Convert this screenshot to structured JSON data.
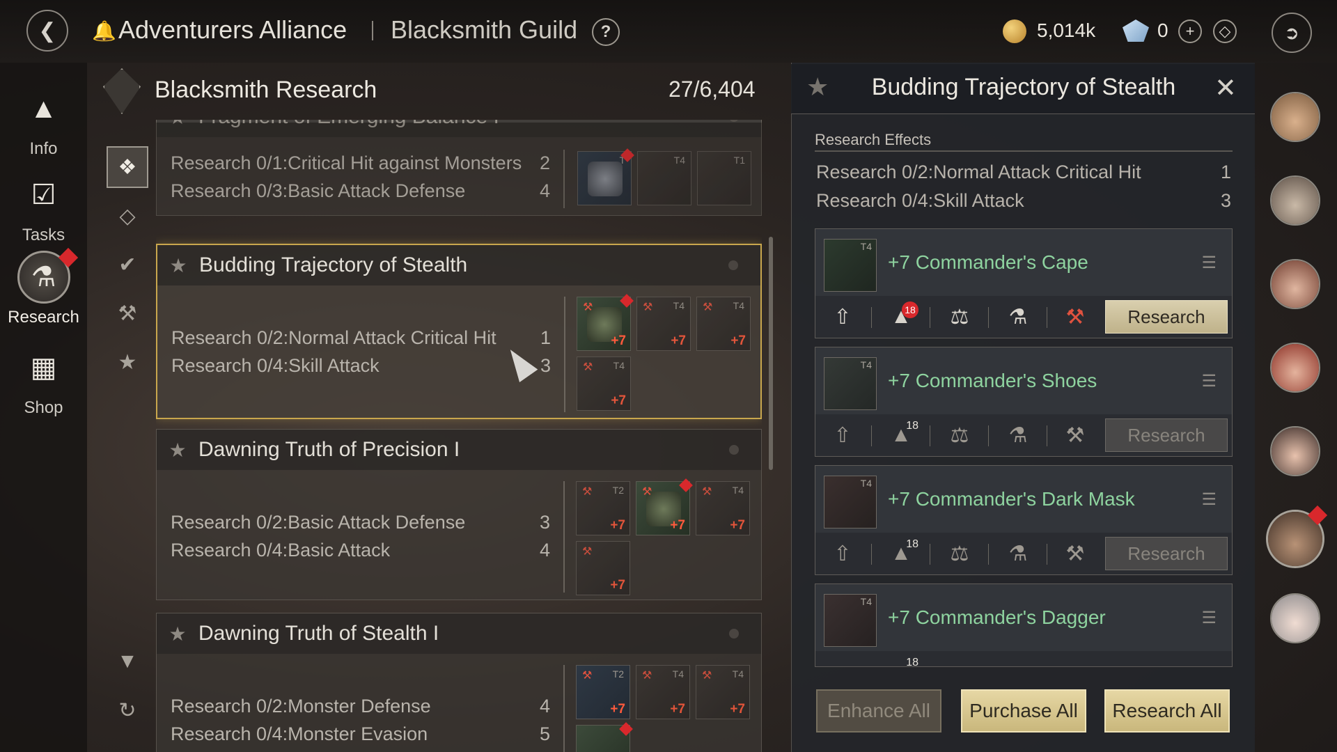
{
  "topbar": {
    "breadcrumb_1": "Adventurers Alliance",
    "breadcrumb_2": "Blacksmith Guild",
    "help": "?",
    "gold": "5,014k",
    "gems": "0",
    "add": "+",
    "more": "◇"
  },
  "leftnav": {
    "items": [
      {
        "label": "Info",
        "icon": "info-icon"
      },
      {
        "label": "Tasks",
        "icon": "tasks-icon"
      },
      {
        "label": "Research",
        "icon": "research-flask-icon"
      },
      {
        "label": "Shop",
        "icon": "shop-chest-icon"
      }
    ]
  },
  "panel": {
    "title": "Blacksmith Research",
    "count": "27/6,404"
  },
  "research_list": [
    {
      "title": "Fragment of Emerging Balance I",
      "effects": [
        {
          "text": "Research 0/1:Critical Hit against Monsters",
          "value": "2"
        },
        {
          "text": "Research 0/3:Basic Attack Defense",
          "value": "4"
        }
      ]
    },
    {
      "title": "Budding Trajectory of Stealth",
      "effects": [
        {
          "text": "Research 0/2:Normal Attack Critical Hit",
          "value": "1"
        },
        {
          "text": "Research 0/4:Skill Attack",
          "value": "3"
        }
      ]
    },
    {
      "title": "Dawning Truth of Precision I",
      "effects": [
        {
          "text": "Research 0/2:Basic Attack Defense",
          "value": "3"
        },
        {
          "text": "Research 0/4:Basic Attack",
          "value": "4"
        }
      ]
    },
    {
      "title": "Dawning Truth of Stealth I",
      "effects": [
        {
          "text": "Research 0/2:Monster Defense",
          "value": "4"
        },
        {
          "text": "Research 0/4:Monster Evasion",
          "value": "5"
        }
      ]
    }
  ],
  "slots": {
    "plus": "+7",
    "t4": "T4",
    "t2": "T2",
    "t1": "T1",
    "t": "T"
  },
  "detail": {
    "title": "Budding Trajectory of Stealth",
    "close": "✕",
    "effects_label": "Research Effects",
    "effects": [
      {
        "text": "Research 0/2:Normal Attack Critical Hit",
        "value": "1"
      },
      {
        "text": "Research 0/4:Skill Attack",
        "value": "3"
      }
    ],
    "items": [
      {
        "name": "+7 Commander's Cape",
        "tier": "T4",
        "level": "18",
        "button": "Research",
        "enabled": true
      },
      {
        "name": "+7 Commander's Shoes",
        "tier": "T4",
        "level": "18",
        "button": "Research",
        "enabled": false
      },
      {
        "name": "+7 Commander's Dark Mask",
        "tier": "T4",
        "level": "18",
        "button": "Research",
        "enabled": false
      },
      {
        "name": "+7 Commander's Dagger",
        "tier": "T4",
        "level": "18",
        "button": "",
        "enabled": false
      }
    ],
    "buttons": {
      "enhance_all": "Enhance All",
      "purchase_all": "Purchase All",
      "research_all": "Research All"
    }
  },
  "colors": {
    "accent_gold": "#c9a74d",
    "item_name": "#8ed39f",
    "badge_red": "#d8282c",
    "plus_red": "#ff5a3c"
  }
}
